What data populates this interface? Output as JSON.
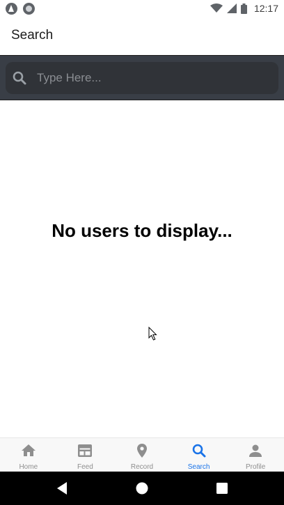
{
  "status_bar": {
    "time": "12:17",
    "left_icons": [
      "app-indicator-icon",
      "record-indicator-icon"
    ],
    "right_icons": [
      "wifi-icon",
      "signal-icon",
      "battery-icon"
    ]
  },
  "header": {
    "title": "Search"
  },
  "search": {
    "placeholder": "Type Here...",
    "value": "",
    "icon": "search-icon"
  },
  "main": {
    "empty_message": "No users to display..."
  },
  "tabs": [
    {
      "label": "Home",
      "icon": "home-icon",
      "active": false
    },
    {
      "label": "Feed",
      "icon": "feed-icon",
      "active": false
    },
    {
      "label": "Record",
      "icon": "location-pin-icon",
      "active": false
    },
    {
      "label": "Search",
      "icon": "search-icon",
      "active": true
    },
    {
      "label": "Profile",
      "icon": "person-icon",
      "active": false
    }
  ],
  "nav_bar": {
    "buttons": [
      "back-icon",
      "home-circle-icon",
      "recents-icon"
    ]
  },
  "colors": {
    "search_bar_bg": "#393e46",
    "search_field_bg": "#303338",
    "active_tab": "#1a73e8",
    "inactive_tab": "#8e8e8e"
  }
}
